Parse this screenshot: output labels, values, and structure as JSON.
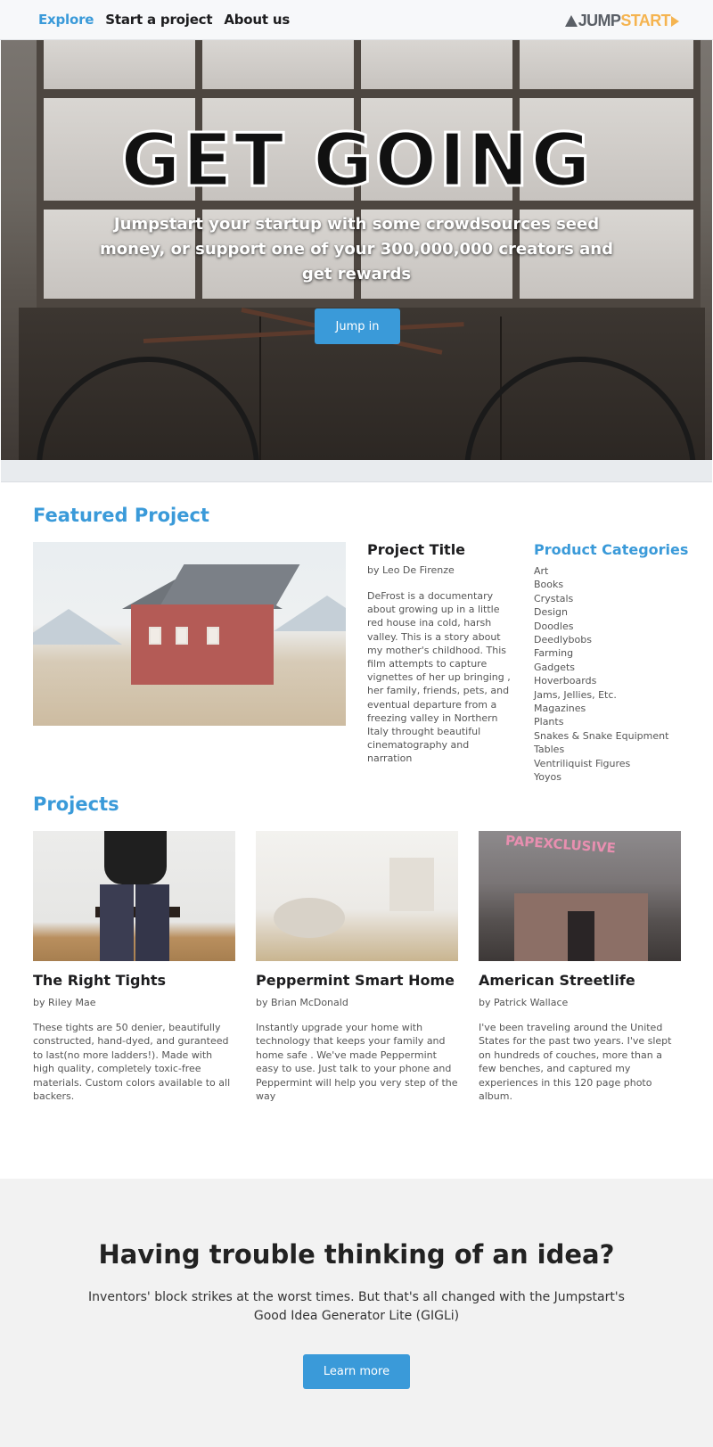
{
  "nav": {
    "links": [
      {
        "label": "Explore",
        "active": true
      },
      {
        "label": "Start a project",
        "active": false
      },
      {
        "label": "About us",
        "active": false
      }
    ],
    "logo": {
      "part1": "JUMP",
      "part2": "START"
    },
    "colors": {
      "accent": "#3a9ad9",
      "logo_dark": "#5a5f66",
      "logo_orange": "#f5b450"
    }
  },
  "hero": {
    "title": "GET GOING",
    "subtitle": "Jumpstart your startup with some crowdsources seed money, or support one of your 300,000,000 creators and get rewards",
    "button_label": "Jump in"
  },
  "featured": {
    "heading": "Featured Project",
    "project_title": "Project Title",
    "author": "by Leo De Firenze",
    "description": "DeFrost is a documentary about growing up in a little red house ina cold, harsh valley. This is a story about my mother's childhood. This film attempts to capture vignettes of her up bringing , her family, friends, pets, and eventual departure from a freezing valley in Northern Italy throught beautiful cinematography and narration",
    "categories_heading": "Product Categories",
    "categories": [
      "Art",
      "Books",
      "Crystals",
      "Design",
      "Doodles",
      "Deedlybobs",
      "Farming",
      "Gadgets",
      "Hoverboards",
      "Jams, Jellies, Etc.",
      "Magazines",
      "Plants",
      "Snakes & Snake Equipment",
      "Tables",
      "Ventriliquist Figures",
      "Yoyos"
    ]
  },
  "projects": {
    "heading": "Projects",
    "items": [
      {
        "title": "The Right Tights",
        "author": "by Riley Mae",
        "description": "These tights are 50 denier, beautifully constructed, hand-dyed, and guranteed to last(no more ladders!). Made with high quality, completely toxic-free materials. Custom colors available to all backers."
      },
      {
        "title": "Peppermint Smart Home",
        "author": "by Brian McDonald",
        "description": "Instantly upgrade your home with technology that keeps your family and home safe . We've made Peppermint easy to use. Just talk to your phone and Peppermint will help you very step of the way"
      },
      {
        "title": "American Streetlife",
        "author": "by Patrick Wallace",
        "description": "I've been traveling around the United States for the past two years. I've slept on hundreds of couches, more than a few benches, and captured my experiences in this 120 page photo album.",
        "image_sign": "PAPEXCLUSIVE"
      }
    ]
  },
  "cta": {
    "title": "Having trouble thinking of an idea?",
    "text": "Inventors' block strikes at the worst times. But that's all changed with the Jumpstart's Good Idea Generator Lite (GIGLi)",
    "button_label": "Learn more"
  }
}
